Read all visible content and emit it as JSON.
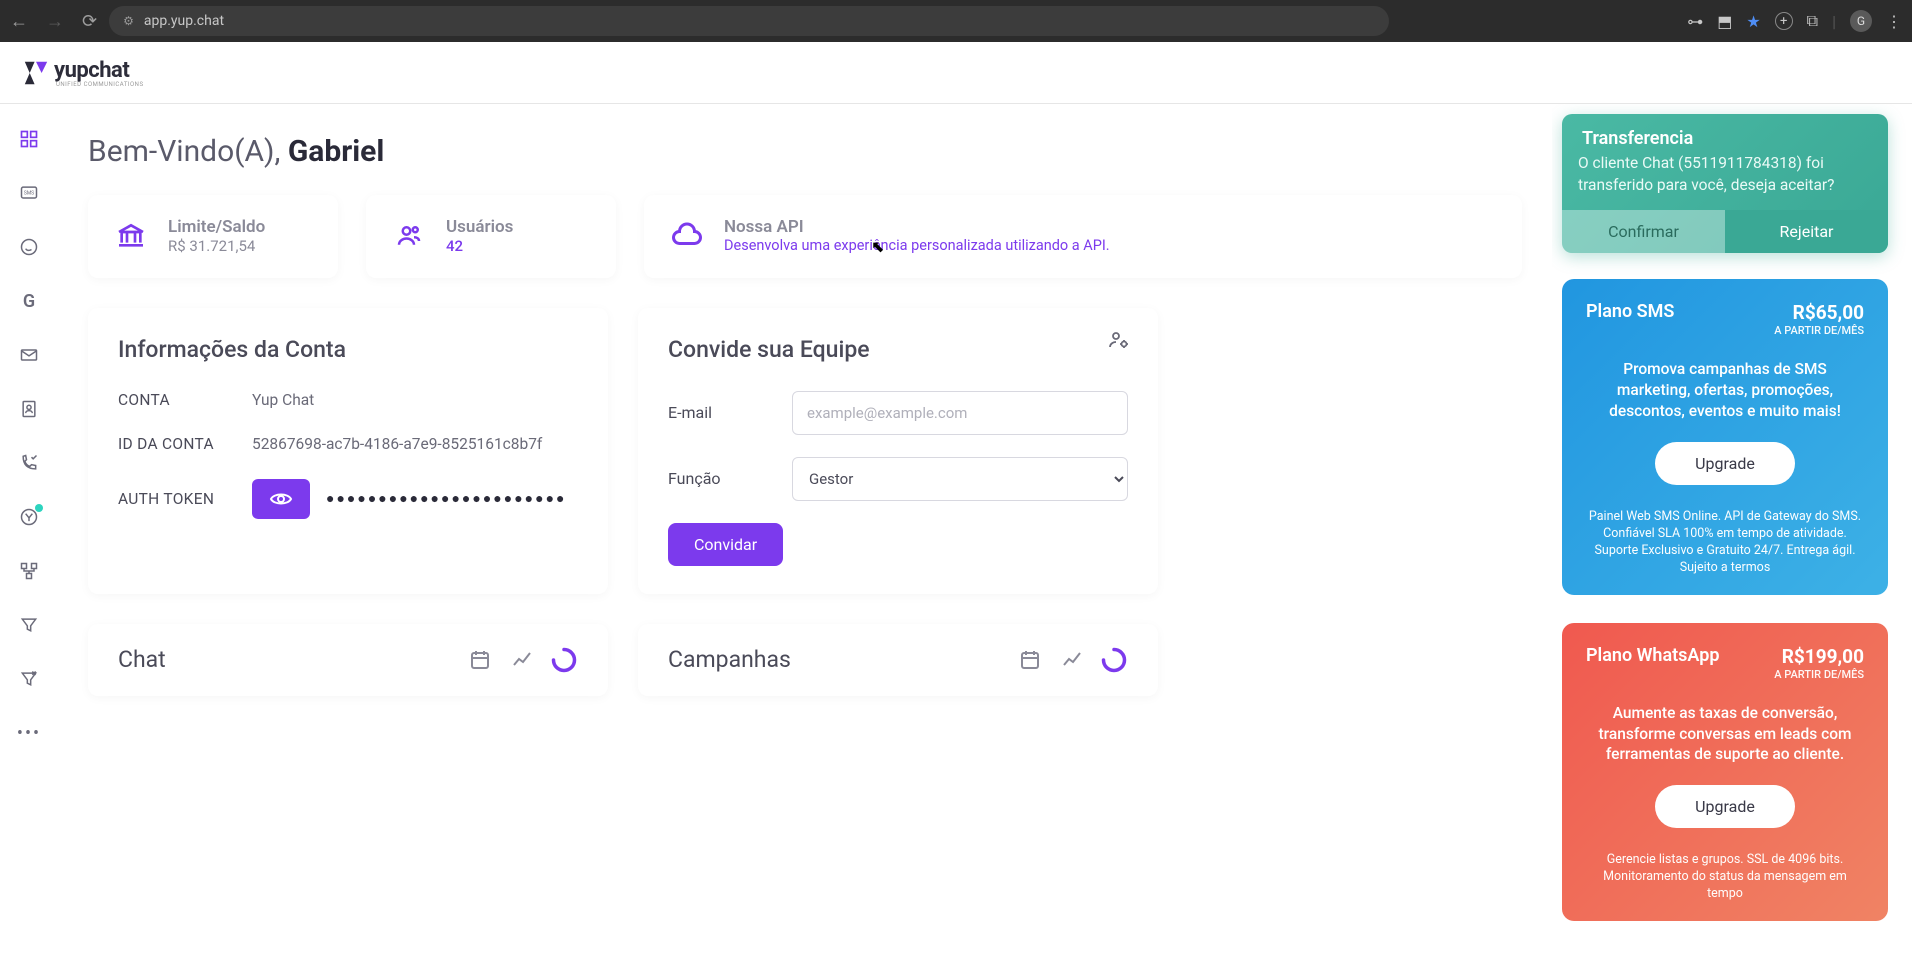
{
  "browser": {
    "url": "app.yup.chat",
    "profile": "G"
  },
  "logo": {
    "text": "yupchat",
    "sub": "UNIFIED COMMUNICATIONS"
  },
  "welcome": {
    "prefix": "Bem-Vindo(A), ",
    "name": "Gabriel"
  },
  "cards": {
    "balance": {
      "title": "Limite/Saldo",
      "value": "R$ 31.721,54"
    },
    "users": {
      "title": "Usuários",
      "value": "42"
    },
    "api": {
      "title": "Nossa API",
      "desc": "Desenvolva uma experiência personalizada utilizando a API."
    }
  },
  "account": {
    "title": "Informações da Conta",
    "labels": {
      "conta": "CONTA",
      "id": "ID DA CONTA",
      "token": "AUTH TOKEN"
    },
    "conta": "Yup Chat",
    "id": "52867698-ac7b-4186-a7e9-8525161c8b7f",
    "token_mask": "●●●●●●●●●●●●●●●●●●●●●●●"
  },
  "invite": {
    "title": "Convide sua Equipe",
    "email_label": "E-mail",
    "email_placeholder": "example@example.com",
    "role_label": "Função",
    "role_value": "Gestor",
    "button": "Convidar"
  },
  "mini": {
    "chat": "Chat",
    "campaigns": "Campanhas"
  },
  "toast": {
    "title": "Transferencia",
    "body": "O cliente Chat (5511911784318) foi transferido para você, deseja aceitar?",
    "confirm": "Confirmar",
    "reject": "Rejeitar"
  },
  "plans": {
    "sms": {
      "name": "Plano SMS",
      "price": "R$65,00",
      "per": "A PARTIR DE/MÊS",
      "desc": "Promova campanhas de SMS marketing, ofertas, promoções, descontos, eventos e muito mais!",
      "cta": "Upgrade",
      "foot": "Painel Web SMS Online. API de Gateway do SMS. Confiável SLA 100% em tempo de atividade. Suporte Exclusivo e Gratuito 24/7. Entrega ágil. Sujeito a termos"
    },
    "wa": {
      "name": "Plano WhatsApp",
      "price": "R$199,00",
      "per": "A PARTIR DE/MÊS",
      "desc": "Aumente as taxas de conversão, transforme conversas em leads com ferramentas de suporte ao cliente.",
      "cta": "Upgrade",
      "foot": "Gerencie listas e grupos. SSL de 4096 bits. Monitoramento do status da mensagem em tempo"
    }
  }
}
